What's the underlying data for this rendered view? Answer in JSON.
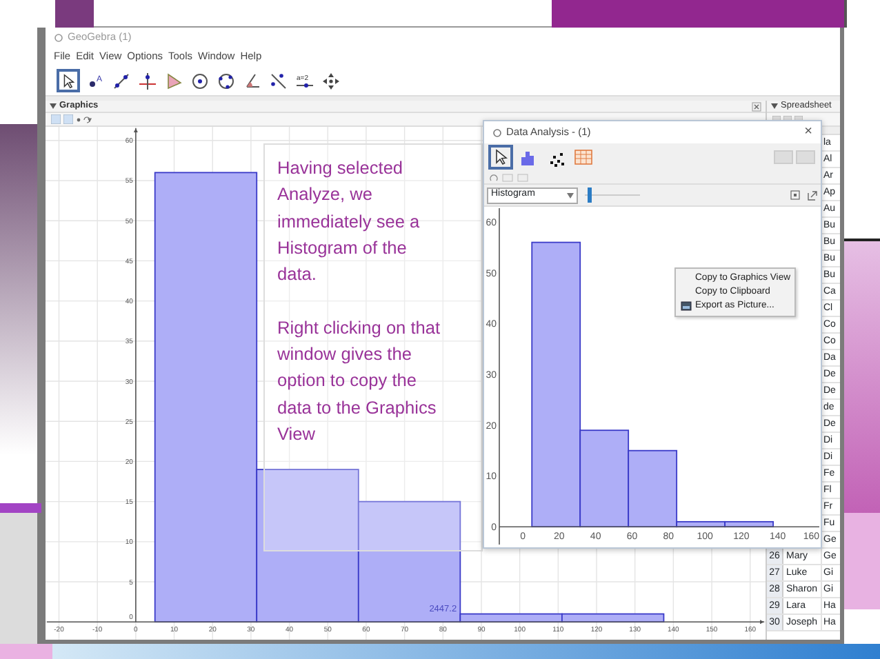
{
  "callout": {
    "paragraphs": [
      "Having selected Analyze, we immediately see a Histogram of the data.",
      "Right clicking on that window gives the option to copy the data to the Graphics View"
    ]
  },
  "window": {
    "title": "GeoGebra (1)",
    "menu": [
      "File",
      "Edit",
      "View",
      "Options",
      "Tools",
      "Window",
      "Help"
    ],
    "tools": [
      {
        "kind": "move",
        "selected": true
      },
      {
        "kind": "point",
        "label": "A",
        "selected": false
      },
      {
        "kind": "line",
        "selected": false
      },
      {
        "kind": "perpendicular",
        "selected": false
      },
      {
        "kind": "polygon",
        "selected": false
      },
      {
        "kind": "circle",
        "selected": false
      },
      {
        "kind": "circle3",
        "selected": false
      },
      {
        "kind": "angle",
        "selected": false
      },
      {
        "kind": "reflect",
        "selected": false
      },
      {
        "kind": "slider",
        "label": "a=2",
        "selected": false
      },
      {
        "kind": "pan",
        "selected": false
      }
    ]
  },
  "graphics": {
    "title": "Graphics",
    "area_label": "2447.2",
    "chart_data": {
      "type": "bar",
      "grid": true,
      "x": [
        18.25,
        44.75,
        71.25,
        97.75,
        124.25
      ],
      "values": [
        56,
        19,
        15,
        1,
        1
      ],
      "xlim": [
        -23.5,
        164
      ],
      "ylim": [
        -2.9,
        61.7
      ],
      "xticks": [
        -20,
        -10,
        0,
        10,
        20,
        30,
        40,
        50,
        60,
        70,
        80,
        90,
        100,
        110,
        120,
        130,
        140,
        150,
        160
      ],
      "yticks": [
        0,
        5,
        10,
        15,
        20,
        25,
        30,
        35,
        40,
        45,
        50,
        55,
        60
      ]
    }
  },
  "spreadsheet": {
    "title": "Spreadsheet",
    "rows": [
      {
        "column_3": "la"
      },
      {
        "column_3": "Al"
      },
      {
        "column_3": "Ar"
      },
      {
        "column_3": "Ap"
      },
      {
        "column_3": "Au"
      },
      {
        "column_3": "Bu"
      },
      {
        "column_3": "Bu"
      },
      {
        "column_3": "Bu"
      },
      {
        "column_3": "Bu"
      },
      {
        "column_3": "Ca"
      },
      {
        "column_3": "Cl"
      },
      {
        "column_3": "Co"
      },
      {
        "column_3": "Co"
      },
      {
        "column_3": "Da"
      },
      {
        "column_3": "De"
      },
      {
        "column_3": "De"
      },
      {
        "column_3": "de"
      },
      {
        "column_3": "De"
      },
      {
        "column_3": "Di"
      },
      {
        "column_3": "Di"
      },
      {
        "column_3": "Fe"
      },
      {
        "column_3": "Fl"
      },
      {
        "column_3": "Fr"
      },
      {
        "column_3": "Fu"
      },
      {
        "column_3": "Ge"
      },
      {
        "row_number": "26",
        "column_2": "Mary",
        "column_3": "Ge"
      },
      {
        "row_number": "27",
        "column_2": "Luke",
        "column_3": "Gi"
      },
      {
        "row_number": "28",
        "column_2": "Sharon",
        "column_3": "Gi"
      },
      {
        "row_number": "29",
        "column_2": "Lara",
        "column_3": "Ha"
      },
      {
        "row_number": "30",
        "column_2": "Joseph",
        "column_3": "Ha"
      }
    ]
  },
  "data_analysis": {
    "title": "Data Analysis - (1)",
    "close": "×",
    "tools": [
      {
        "kind": "move",
        "selected": true
      },
      {
        "kind": "histogram",
        "selected": false
      },
      {
        "kind": "scatter",
        "selected": false
      },
      {
        "kind": "table",
        "selected": false
      }
    ],
    "display": "Histogram",
    "slider": {
      "level": 0.05
    },
    "chart_data": {
      "type": "bar",
      "x": [
        18.25,
        44.75,
        71.25,
        97.75,
        124.25
      ],
      "values": [
        56,
        19,
        15,
        1,
        1
      ],
      "xlim": [
        -12.9,
        163.6
      ],
      "ylim": [
        -3.5,
        63
      ],
      "xticks": [
        0,
        20,
        40,
        60,
        80,
        100,
        120,
        140,
        160
      ],
      "yticks": [
        0,
        10,
        20,
        30,
        40,
        50,
        60
      ]
    },
    "context_menu": [
      {
        "label": "Copy to Graphics View",
        "kind": "plain"
      },
      {
        "label": "Copy to Clipboard",
        "kind": "plain"
      },
      {
        "label": "Export as Picture...",
        "kind": "icon"
      }
    ]
  }
}
